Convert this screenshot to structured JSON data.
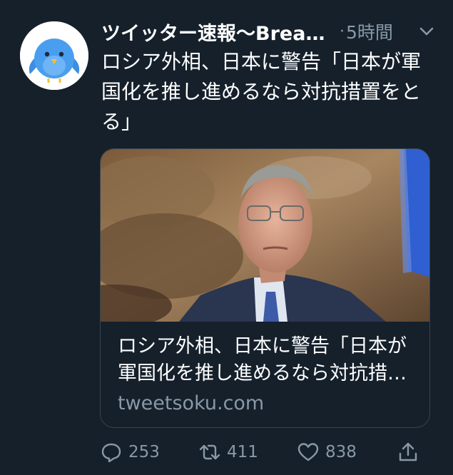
{
  "tweet": {
    "display_name": "ツイッター速報〜BreakingNews",
    "separator": "·",
    "time": "5時間",
    "text": "ロシア外相、日本に警告「日本が軍国化を推し進めるなら対抗措置をとる」",
    "avatar_icon": "bird-icon",
    "menu_icon": "chevron-down-icon"
  },
  "card": {
    "title": "ロシア外相、日本に警告「日本が軍国化を推し進めるなら対抗措置をとる」",
    "domain": "tweetsoku.com",
    "image_description_icon": "news-photo"
  },
  "actions": {
    "reply_count": "253",
    "retweet_count": "411",
    "like_count": "838",
    "reply_icon": "reply-icon",
    "retweet_icon": "retweet-icon",
    "like_icon": "heart-icon",
    "share_icon": "share-icon"
  },
  "colors": {
    "background": "#15202b",
    "text_primary": "#ffffff",
    "text_secondary": "#8899a6",
    "border": "#38444d"
  }
}
